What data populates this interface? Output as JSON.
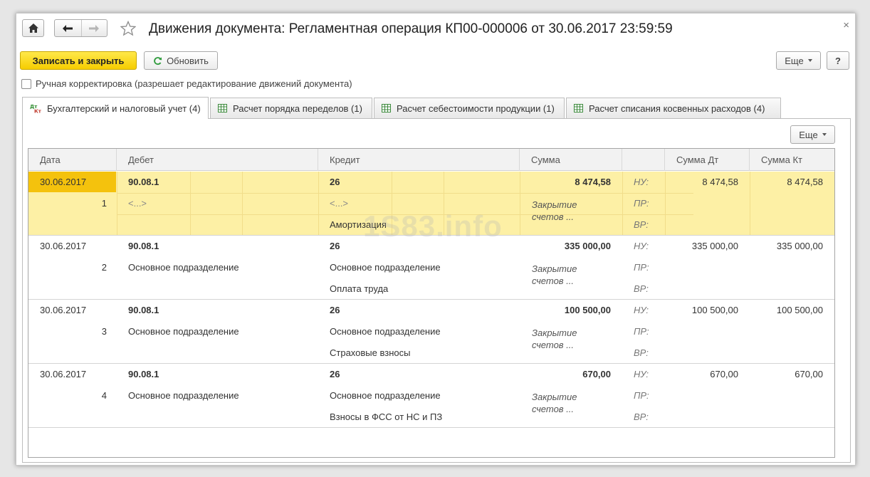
{
  "window": {
    "title": "Движения документа: Регламентная операция КП00-000006 от 30.06.2017 23:59:59",
    "close": "×"
  },
  "toolbar": {
    "save_close": "Записать и закрыть",
    "refresh": "Обновить",
    "more": "Еще",
    "help": "?"
  },
  "manual_edit": {
    "label": "Ручная корректировка (разрешает редактирование движений документа)",
    "checked": false
  },
  "tabs": [
    {
      "label": "Бухгалтерский и налоговый учет (4)",
      "active": true,
      "icon": "dt-kt-icon"
    },
    {
      "label": "Расчет порядка переделов (1)",
      "active": false,
      "icon": "table-icon"
    },
    {
      "label": "Расчет себестоимости продукции (1)",
      "active": false,
      "icon": "table-icon"
    },
    {
      "label": "Расчет списания косвенных расходов (4)",
      "active": false,
      "icon": "table-icon"
    }
  ],
  "grid": {
    "more": "Еще",
    "columns": {
      "date": "Дата",
      "debit": "Дебет",
      "credit": "Кредит",
      "sum": "Сумма",
      "blank": "",
      "sum_dt": "Сумма Дт",
      "sum_kt": "Сумма Кт"
    },
    "rows": [
      {
        "date": "30.06.2017",
        "num": "1",
        "debit_acc": "90.08.1",
        "debit_sub1": "<...>",
        "debit_sub2": "",
        "credit_acc": "26",
        "credit_sub1": "<...>",
        "credit_sub2": "Амортизация",
        "sum": "8 474,58",
        "comment": "Закрытие счетов ...",
        "nu": "НУ:",
        "pr": "ПР:",
        "vr": "ВР:",
        "sum_dt": "8 474,58",
        "sum_kt": "8 474,58",
        "selected": true
      },
      {
        "date": "30.06.2017",
        "num": "2",
        "debit_acc": "90.08.1",
        "debit_sub1": "Основное подразделение",
        "debit_sub2": "",
        "credit_acc": "26",
        "credit_sub1": "Основное подразделение",
        "credit_sub2": "Оплата труда",
        "sum": "335 000,00",
        "comment": "Закрытие счетов ...",
        "nu": "НУ:",
        "pr": "ПР:",
        "vr": "ВР:",
        "sum_dt": "335 000,00",
        "sum_kt": "335 000,00",
        "selected": false
      },
      {
        "date": "30.06.2017",
        "num": "3",
        "debit_acc": "90.08.1",
        "debit_sub1": "Основное подразделение",
        "debit_sub2": "",
        "credit_acc": "26",
        "credit_sub1": "Основное подразделение",
        "credit_sub2": "Страховые взносы",
        "sum": "100 500,00",
        "comment": "Закрытие счетов ...",
        "nu": "НУ:",
        "pr": "ПР:",
        "vr": "ВР:",
        "sum_dt": "100 500,00",
        "sum_kt": "100 500,00",
        "selected": false
      },
      {
        "date": "30.06.2017",
        "num": "4",
        "debit_acc": "90.08.1",
        "debit_sub1": "Основное подразделение",
        "debit_sub2": "",
        "credit_acc": "26",
        "credit_sub1": "Основное подразделение",
        "credit_sub2": "Взносы в ФСС от НС и ПЗ",
        "sum": "670,00",
        "comment": "Закрытие счетов ...",
        "nu": "НУ:",
        "pr": "ПР:",
        "vr": "ВР:",
        "sum_dt": "670,00",
        "sum_kt": "670,00",
        "selected": false
      }
    ]
  },
  "watermark": "1S83.info",
  "colors": {
    "primary_button": "#f6cd00",
    "selected_row": "#fdf0a5",
    "selected_cell": "#f4c20d"
  }
}
